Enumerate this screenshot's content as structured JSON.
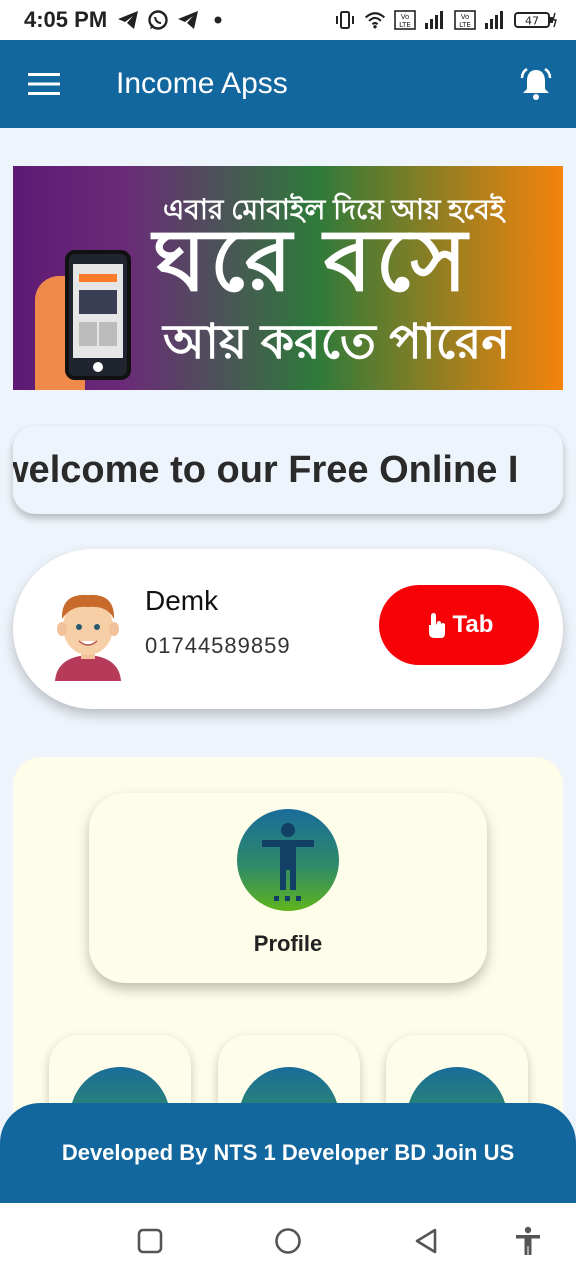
{
  "status_bar": {
    "time": "4:05 PM",
    "battery": "47",
    "icons": [
      "telegram-icon",
      "whatsapp-icon",
      "telegram-icon",
      "dot-icon",
      "vibrate-icon",
      "wifi-icon",
      "volte-icon",
      "signal-icon",
      "volte-icon",
      "signal-icon",
      "battery-icon"
    ]
  },
  "app_bar": {
    "title": "Income Apss",
    "menu_icon": "hamburger-menu-icon",
    "notification_icon": "bell-icon"
  },
  "banner": {
    "line1": "এবার মোবাইল দিয়ে আয় হবেই",
    "line2": "ঘরে বসে",
    "line3": "আয় করতে পারেন"
  },
  "marquee": {
    "text": "welcome to our Free Online I"
  },
  "user": {
    "name": "Demk",
    "phone": "01744589859",
    "tab_label": "Tab",
    "tab_icon": "tap-hand-icon"
  },
  "menu": {
    "profile_label": "Profile",
    "profile_icon": "person-accessibility-icon"
  },
  "footer": {
    "text": "Developed By NTS 1 Developer BD Join US"
  },
  "nav_bar": {
    "recents_icon": "square-icon",
    "home_icon": "circle-icon",
    "back_icon": "triangle-back-icon",
    "accessibility_icon": "accessibility-icon"
  },
  "colors": {
    "primary": "#12679f",
    "tab_button": "#f70307",
    "panel_bg": "#fefde9",
    "page_bg": "#eef4fb"
  }
}
